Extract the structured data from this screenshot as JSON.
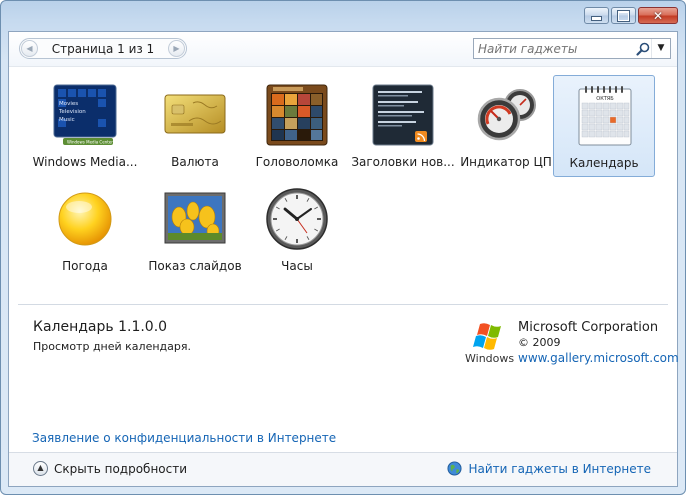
{
  "window": {
    "close_glyph": "✕"
  },
  "toolbar": {
    "pager_text": "Страница 1 из 1",
    "prev_glyph": "◀",
    "next_glyph": "▶",
    "search_placeholder": "Найти гаджеты",
    "search_dropdown_glyph": "▼"
  },
  "gadgets": [
    {
      "label": "Windows Media...",
      "icon": "windows-media-center-icon",
      "selected": false
    },
    {
      "label": "Валюта",
      "icon": "currency-card-icon",
      "selected": false
    },
    {
      "label": "Головоломка",
      "icon": "puzzle-icon",
      "selected": false
    },
    {
      "label": "Заголовки нов...",
      "icon": "news-feed-icon",
      "selected": false
    },
    {
      "label": "Индикатор ЦП",
      "icon": "cpu-meter-icon",
      "selected": false
    },
    {
      "label": "Календарь",
      "icon": "calendar-icon",
      "selected": true
    },
    {
      "label": "Погода",
      "icon": "weather-sun-icon",
      "selected": false
    },
    {
      "label": "Показ слайдов",
      "icon": "slideshow-icon",
      "selected": false
    },
    {
      "label": "Часы",
      "icon": "clock-icon",
      "selected": false
    }
  ],
  "wmc_thumb": {
    "lines": [
      "Movies",
      "Television",
      "Music"
    ],
    "brand": "Windows Media Center"
  },
  "calendar_thumb": {
    "month": "ОКТЯБ"
  },
  "details": {
    "title": "Календарь 1.1.0.0",
    "description": "Просмотр дней календаря.",
    "publisher": "Microsoft Corporation",
    "copyright": "© 2009",
    "publisher_link": "www.gallery.microsoft.com",
    "logo_text": "Windows",
    "privacy_link": "Заявление о конфиденциальности в Интернете"
  },
  "footer": {
    "hide_details_glyph": "▲",
    "hide_details": "Скрыть подробности",
    "get_online": "Найти гаджеты в Интернете"
  },
  "colors": {
    "link": "#1565b5",
    "selection_border": "#84acd8",
    "selection_fill": "#d5e6f8",
    "close_button": "#c43d25"
  }
}
